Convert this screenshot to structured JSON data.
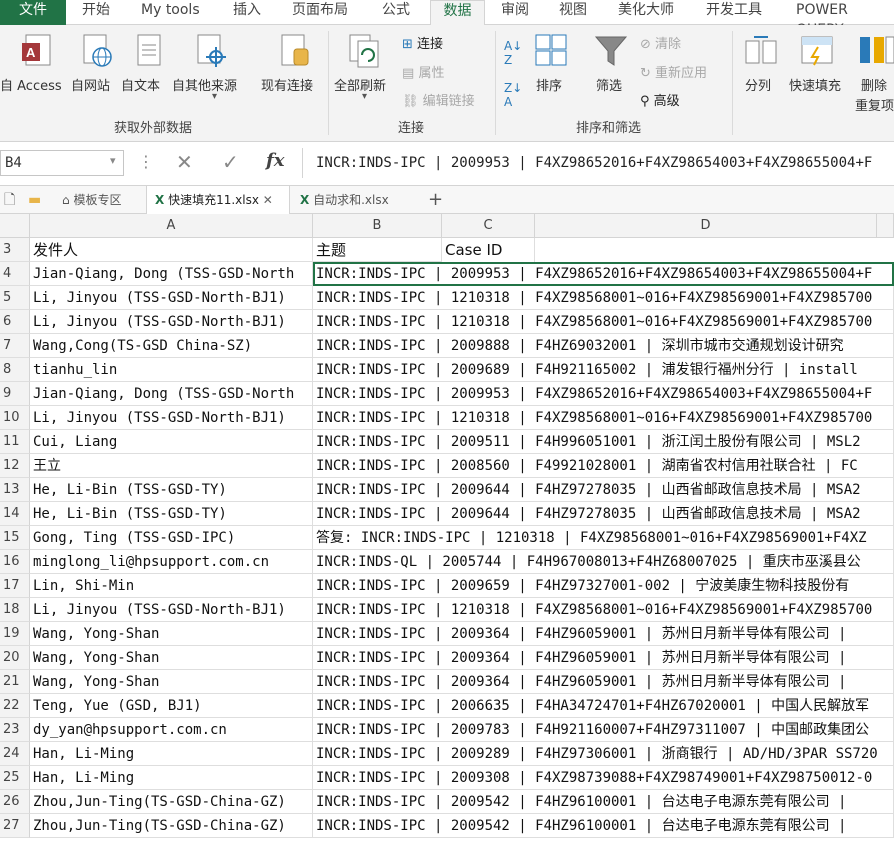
{
  "menu_tabs": [
    "文件",
    "开始",
    "My tools",
    "插入",
    "页面布局",
    "公式",
    "数据",
    "审阅",
    "视图",
    "美化大师",
    "开发工具",
    "POWER QUERY"
  ],
  "ribbon": {
    "get_external": {
      "buttons": [
        "自 Access",
        "自网站",
        "自文本",
        "自其他来源",
        "现有连接"
      ],
      "group_label": "获取外部数据"
    },
    "connections": {
      "refresh_all": "全部刷新",
      "items": [
        "连接",
        "属性",
        "编辑链接"
      ],
      "group_label": "连接"
    },
    "sort_filter": {
      "sort": "排序",
      "filter": "筛选",
      "items": [
        "清除",
        "重新应用",
        "高级"
      ],
      "group_label": "排序和筛选"
    },
    "data_tools": {
      "buttons": [
        "分列",
        "快速填充",
        "删除",
        "重复项"
      ]
    }
  },
  "formula_bar": {
    "name_box": "B4",
    "fx": "fx",
    "formula": "INCR:INDS-IPC | 2009953 | F4XZ98652016+F4XZ98654003+F4XZ98655004+F"
  },
  "workbook_tabs": [
    "模板专区",
    "快速填充11.xlsx",
    "自动求和.xlsx"
  ],
  "columns": [
    "A",
    "B",
    "C",
    "D"
  ],
  "rows": [
    {
      "n": "3",
      "a": "发件人",
      "b": "主题",
      "c": "Case ID",
      "d": ""
    },
    {
      "n": "4",
      "a": "Jian-Qiang, Dong (TSS-GSD-North",
      "b": "INCR:INDS-IPC | 2009953 | F4XZ98652016+F4XZ98654003+F4XZ98655004+F",
      "c": "",
      "d": ""
    },
    {
      "n": "5",
      "a": "Li, Jinyou (TSS-GSD-North-BJ1)",
      "b": "INCR:INDS-IPC | 1210318 | F4XZ98568001~016+F4XZ98569001+F4XZ985700",
      "c": "",
      "d": ""
    },
    {
      "n": "6",
      "a": "Li, Jinyou (TSS-GSD-North-BJ1)",
      "b": "INCR:INDS-IPC | 1210318 | F4XZ98568001~016+F4XZ98569001+F4XZ985700",
      "c": "",
      "d": ""
    },
    {
      "n": "7",
      "a": "Wang,Cong(TS-GSD China-SZ)",
      "b": "INCR:INDS-IPC | 2009888 | F4HZ69032001 | 深圳市城市交通规划设计研究",
      "c": "",
      "d": ""
    },
    {
      "n": "8",
      "a": "tianhu_lin",
      "b": "INCR:INDS-IPC | 2009689 | F4H921165002 | 浦发银行福州分行 | install",
      "c": "",
      "d": ""
    },
    {
      "n": "9",
      "a": "Jian-Qiang, Dong (TSS-GSD-North",
      "b": "INCR:INDS-IPC | 2009953 | F4XZ98652016+F4XZ98654003+F4XZ98655004+F",
      "c": "",
      "d": ""
    },
    {
      "n": "10",
      "a": "Li, Jinyou (TSS-GSD-North-BJ1)",
      "b": "INCR:INDS-IPC | 1210318 | F4XZ98568001~016+F4XZ98569001+F4XZ985700",
      "c": "",
      "d": ""
    },
    {
      "n": "11",
      "a": "Cui, Liang",
      "b": "INCR:INDS-IPC | 2009511 | F4H996051001 | 浙江闰土股份有限公司 | MSL2",
      "c": "",
      "d": ""
    },
    {
      "n": "12",
      "a": "王立",
      "b": "INCR:INDS-IPC | 2008560 | F49921028001 | 湖南省农村信用社联合社 | FC",
      "c": "",
      "d": ""
    },
    {
      "n": "13",
      "a": "He, Li-Bin (TSS-GSD-TY)",
      "b": "INCR:INDS-IPC | 2009644 | F4HZ97278035 | 山西省邮政信息技术局 | MSA2",
      "c": "",
      "d": ""
    },
    {
      "n": "14",
      "a": "He, Li-Bin (TSS-GSD-TY)",
      "b": "INCR:INDS-IPC | 2009644 | F4HZ97278035 | 山西省邮政信息技术局 | MSA2",
      "c": "",
      "d": ""
    },
    {
      "n": "15",
      "a": "Gong, Ting (TSS-GSD-IPC)",
      "b": "答复: INCR:INDS-IPC | 1210318 | F4XZ98568001~016+F4XZ98569001+F4XZ",
      "c": "",
      "d": ""
    },
    {
      "n": "16",
      "a": "minglong_li@hpsupport.com.cn",
      "b": "INCR:INDS-QL | 2005744 | F4H967008013+F4HZ68007025 | 重庆市巫溪县公",
      "c": "",
      "d": ""
    },
    {
      "n": "17",
      "a": "Lin, Shi-Min",
      "b": "INCR:INDS-IPC | 2009659 | F4HZ97327001-002 | 宁波美康生物科技股份有",
      "c": "",
      "d": ""
    },
    {
      "n": "18",
      "a": "Li, Jinyou (TSS-GSD-North-BJ1)",
      "b": "INCR:INDS-IPC | 1210318 | F4XZ98568001~016+F4XZ98569001+F4XZ985700",
      "c": "",
      "d": ""
    },
    {
      "n": "19",
      "a": "Wang, Yong-Shan",
      "b": "INCR:INDS-IPC | 2009364 | F4HZ96059001 | 苏州日月新半导体有限公司 |",
      "c": "",
      "d": ""
    },
    {
      "n": "20",
      "a": "Wang, Yong-Shan",
      "b": "INCR:INDS-IPC | 2009364 | F4HZ96059001 | 苏州日月新半导体有限公司 |",
      "c": "",
      "d": ""
    },
    {
      "n": "21",
      "a": "Wang, Yong-Shan",
      "b": "INCR:INDS-IPC | 2009364 | F4HZ96059001 | 苏州日月新半导体有限公司 |",
      "c": "",
      "d": ""
    },
    {
      "n": "22",
      "a": "Teng, Yue (GSD, BJ1)",
      "b": "INCR:INDS-IPC | 2006635 | F4HA34724701+F4HZ67020001 | 中国人民解放军",
      "c": "",
      "d": ""
    },
    {
      "n": "23",
      "a": "dy_yan@hpsupport.com.cn",
      "b": "INCR:INDS-IPC | 2009783 | F4H921160007+F4HZ97311007 | 中国邮政集团公",
      "c": "",
      "d": ""
    },
    {
      "n": "24",
      "a": "Han, Li-Ming",
      "b": "INCR:INDS-IPC | 2009289 | F4HZ97306001 | 浙商银行 | AD/HD/3PAR SS720",
      "c": "",
      "d": ""
    },
    {
      "n": "25",
      "a": "Han, Li-Ming",
      "b": "INCR:INDS-IPC | 2009308 | F4XZ98739088+F4XZ98749001+F4XZ98750012-0",
      "c": "",
      "d": ""
    },
    {
      "n": "26",
      "a": "Zhou,Jun-Ting(TS-GSD-China-GZ)",
      "b": "INCR:INDS-IPC | 2009542 | F4HZ96100001 | 台达电子电源东莞有限公司 |",
      "c": "",
      "d": ""
    },
    {
      "n": "27",
      "a": "Zhou,Jun-Ting(TS-GSD-China-GZ)",
      "b": "INCR:INDS-IPC | 2009542 | F4HZ96100001 | 台达电子电源东莞有限公司 |",
      "c": "",
      "d": ""
    }
  ]
}
